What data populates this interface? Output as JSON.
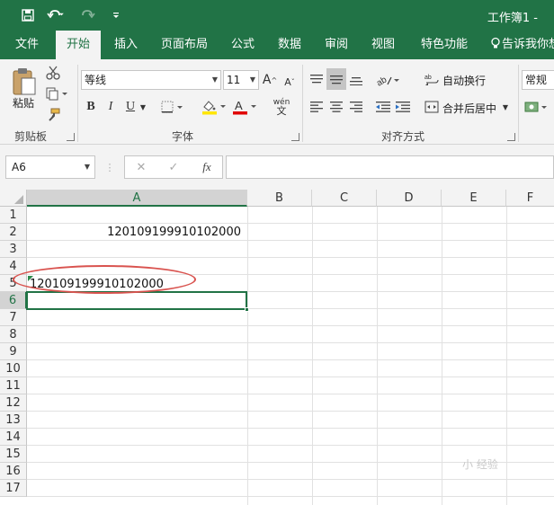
{
  "titlebar": {
    "title": "工作簿1 -",
    "save_icon": "save-icon",
    "undo_icon": "undo-icon",
    "redo_icon": "redo-icon",
    "customize_icon": "customize-qat-icon"
  },
  "tabs": [
    "文件",
    "开始",
    "插入",
    "页面布局",
    "公式",
    "数据",
    "审阅",
    "视图",
    "特色功能"
  ],
  "active_tab": "开始",
  "tell_me": "告诉我你想",
  "clipboard": {
    "label": "剪贴板",
    "paste": "粘贴"
  },
  "font": {
    "label": "字体",
    "font_name": "等线",
    "font_size": "11",
    "bold": "B",
    "italic": "I",
    "underline": "U",
    "grow": "A",
    "shrink": "A",
    "wen": "wén"
  },
  "alignment": {
    "label": "对齐方式",
    "wrap_text": "自动换行",
    "merge_center": "合并后居中"
  },
  "number": {
    "format": "常规"
  },
  "formula_bar": {
    "name_box": "A6",
    "cancel": "✕",
    "enter": "✓",
    "fx": "fx",
    "content": ""
  },
  "sheet": {
    "columns": [
      "A",
      "B",
      "C",
      "D",
      "E",
      "F"
    ],
    "rows": [
      "1",
      "2",
      "3",
      "4",
      "5",
      "6",
      "7",
      "8",
      "9",
      "10",
      "11",
      "12",
      "13",
      "14",
      "15",
      "16",
      "17"
    ],
    "selected_cell": "A6",
    "cells": {
      "A2": "120109199910102000",
      "A5": "120109199910102000"
    }
  },
  "watermark": "小 经验",
  "colors": {
    "accent": "#217346",
    "annotation": "#d9534f"
  }
}
